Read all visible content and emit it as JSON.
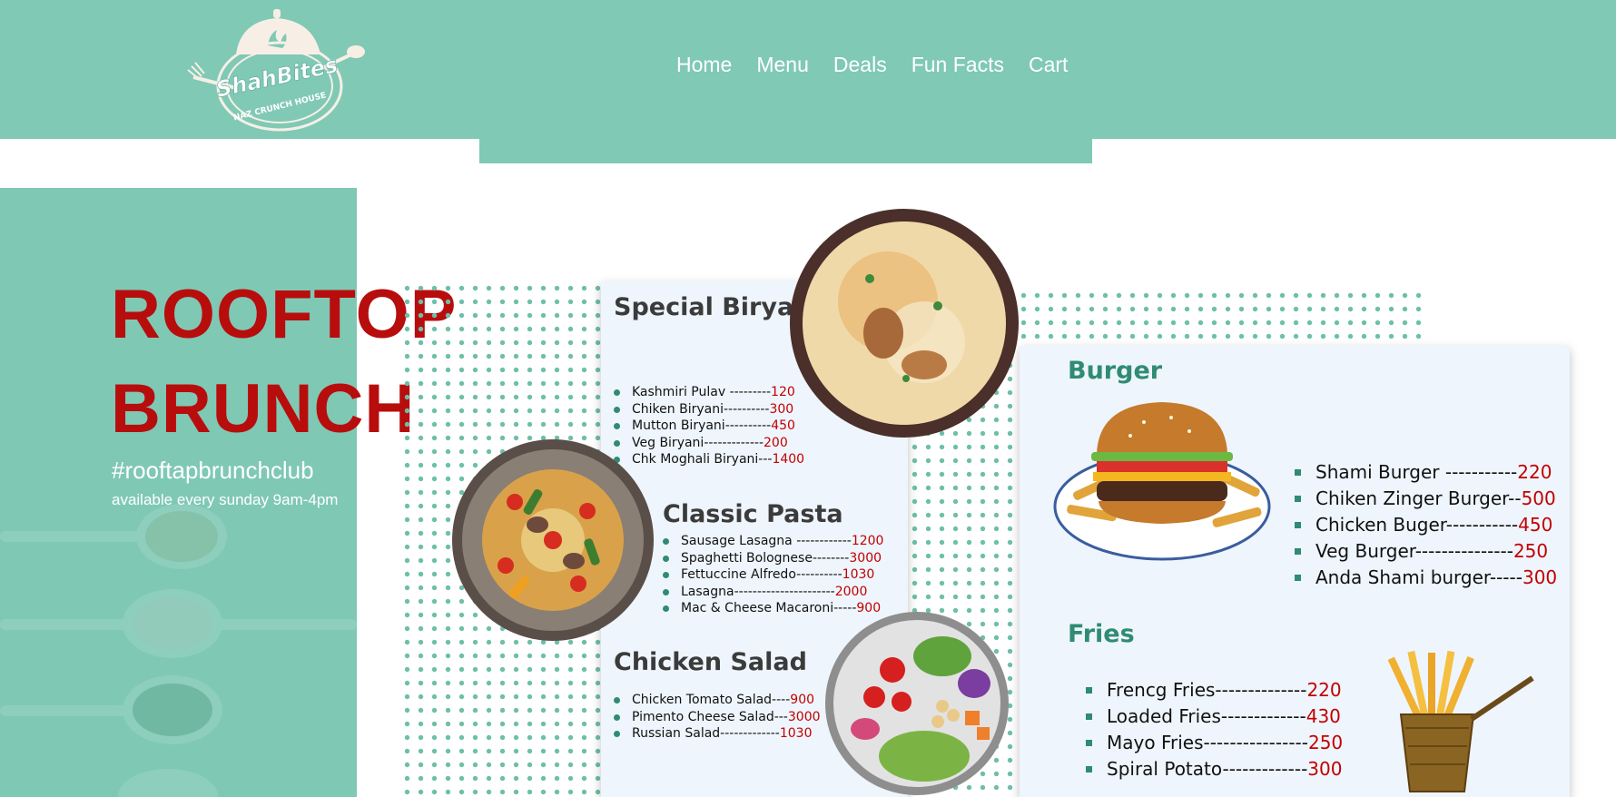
{
  "brand": {
    "name": "ShahBites",
    "tagline": "NAZ CRUNCH HOUSE"
  },
  "nav": {
    "items": [
      "Home",
      "Menu",
      "Deals",
      "Fun Facts",
      "Cart"
    ]
  },
  "hero": {
    "title_line1": "ROOFTOP",
    "title_line2": "BRUNCH",
    "hashtag": "#rooftapbrunchclub",
    "subtitle": "available every sunday 9am-4pm"
  },
  "menu": {
    "biryani": {
      "title": "Special Biryani",
      "items": [
        {
          "name": "Kashmiri Pulav ---------",
          "price": "120"
        },
        {
          "name": "Chiken Biryani----------",
          "price": "300"
        },
        {
          "name": "Mutton Biryani----------",
          "price": "450"
        },
        {
          "name": "Veg Biryani-------------",
          "price": "200"
        },
        {
          "name": "Chk Moghali Biryani---",
          "price": "1400"
        }
      ]
    },
    "pasta": {
      "title": "Classic Pasta",
      "items": [
        {
          "name": "Sausage Lasagna ------------",
          "price": "1200"
        },
        {
          "name": "Spaghetti Bolognese--------",
          "price": "3000"
        },
        {
          "name": "Fettuccine Alfredo----------",
          "price": "1030"
        },
        {
          "name": "Lasagna----------------------",
          "price": "2000"
        },
        {
          "name": "Mac & Cheese Macaroni-----",
          "price": "900"
        }
      ]
    },
    "salad": {
      "title": "Chicken Salad",
      "items": [
        {
          "name": "Chicken Tomato Salad----",
          "price": "900"
        },
        {
          "name": "Pimento Cheese Salad---",
          "price": "3000"
        },
        {
          "name": "Russian Salad-------------",
          "price": "1030"
        }
      ]
    },
    "burger": {
      "title": "Burger",
      "items": [
        {
          "name": "Shami Burger -----------",
          "price": "220"
        },
        {
          "name": "Chiken Zinger Burger--",
          "price": "500"
        },
        {
          "name": "Chicken Buger-----------",
          "price": "450"
        },
        {
          "name": "Veg Burger---------------",
          "price": "250"
        },
        {
          "name": "Anda Shami burger-----",
          "price": "300"
        }
      ]
    },
    "fries": {
      "title": "Fries",
      "items": [
        {
          "name": "Frencg Fries--------------",
          "price": "220"
        },
        {
          "name": "Loaded Fries-------------",
          "price": "430"
        },
        {
          "name": "Mayo Fries----------------",
          "price": "250"
        },
        {
          "name": "Spiral Potato-------------",
          "price": "300"
        }
      ]
    }
  },
  "colors": {
    "mint": "#80c9b5",
    "accent_red": "#b80d0d",
    "price_red": "#c20000",
    "teal_text": "#2f8b73",
    "card_bg": "#eef5fc"
  }
}
